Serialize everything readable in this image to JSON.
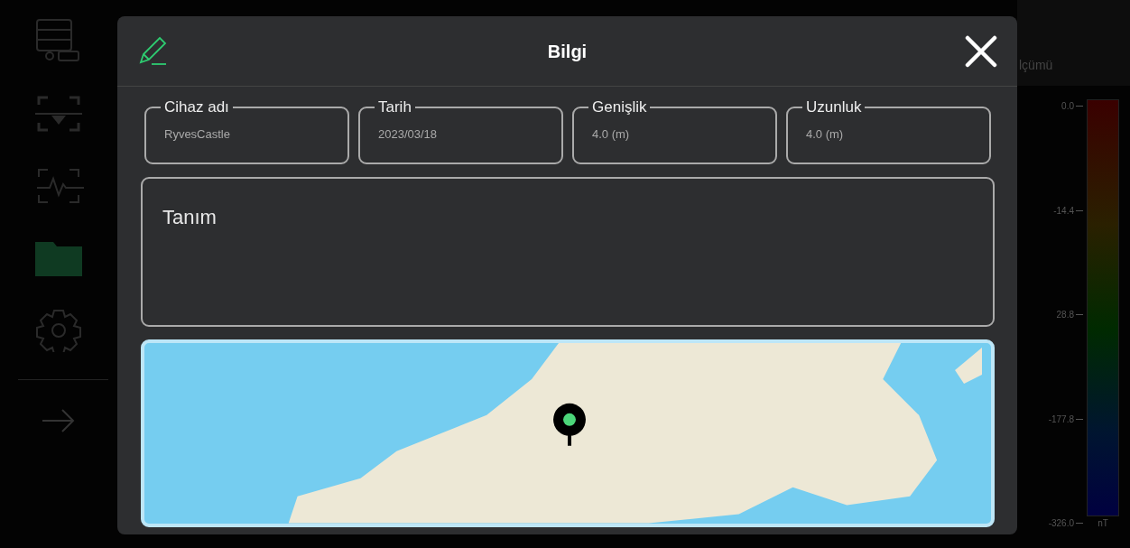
{
  "sidebar": {
    "items": [
      {
        "kind": "device",
        "selected": false
      },
      {
        "kind": "scan",
        "selected": false
      },
      {
        "kind": "signal",
        "selected": false
      },
      {
        "kind": "folder",
        "selected": true
      },
      {
        "kind": "settings",
        "selected": false
      }
    ],
    "footer": {
      "kind": "arrow"
    }
  },
  "top_bar": {
    "label": "lçümü"
  },
  "color_scale": {
    "ticks": [
      "0.0",
      "-14.4",
      "28.8",
      "-177.8",
      "-326.0"
    ],
    "unit": "nT"
  },
  "dialog": {
    "title": "Bilgi",
    "fields": [
      {
        "label": "Cihaz adı",
        "value": "RyvesCastle"
      },
      {
        "label": "Tarih",
        "value": "2023/03/18"
      },
      {
        "label": "Genişlik",
        "value": "4.0 (m)"
      },
      {
        "label": "Uzunluk",
        "value": "4.0 (m)"
      }
    ],
    "description": {
      "placeholder": "Tanım"
    }
  }
}
